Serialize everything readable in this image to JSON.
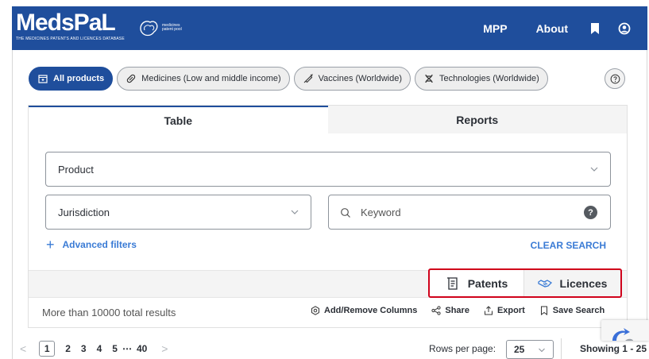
{
  "header": {
    "brand_name": "MedsPaL",
    "brand_sub": "THE MEDICINES PATENTS AND LICENCES DATABASE",
    "partner_logo_text": "medicines patent pool",
    "nav": {
      "mpp": "MPP",
      "about": "About"
    },
    "bg_color": "#1f4e9c"
  },
  "categories": [
    {
      "label": "All products",
      "icon": "box-icon",
      "active": true
    },
    {
      "label": "Medicines (Low and middle income)",
      "icon": "pill-icon",
      "active": false
    },
    {
      "label": "Vaccines (Worldwide)",
      "icon": "syringe-icon",
      "active": false
    },
    {
      "label": "Technologies (Worldwide)",
      "icon": "dna-icon",
      "active": false
    }
  ],
  "tabs": {
    "table": "Table",
    "reports": "Reports"
  },
  "filters": {
    "product_label": "Product",
    "jurisdiction_label": "Jurisdiction",
    "keyword_placeholder": "Keyword",
    "advanced": "Advanced filters",
    "clear": "CLEAR SEARCH"
  },
  "view_toggle": {
    "patents": "Patents",
    "licences": "Licences",
    "highlight_color": "#d0021b"
  },
  "results": {
    "count_text": "More than 10000 total results",
    "actions": {
      "columns": "Add/Remove Columns",
      "share": "Share",
      "export": "Export",
      "save": "Save Search"
    }
  },
  "pagination": {
    "pages": [
      "1",
      "2",
      "3",
      "4",
      "5"
    ],
    "ellipsis": "⋯",
    "last": "40",
    "rows_label": "Rows per page:",
    "rows_value": "25",
    "showing": "Showing 1 - 25"
  }
}
